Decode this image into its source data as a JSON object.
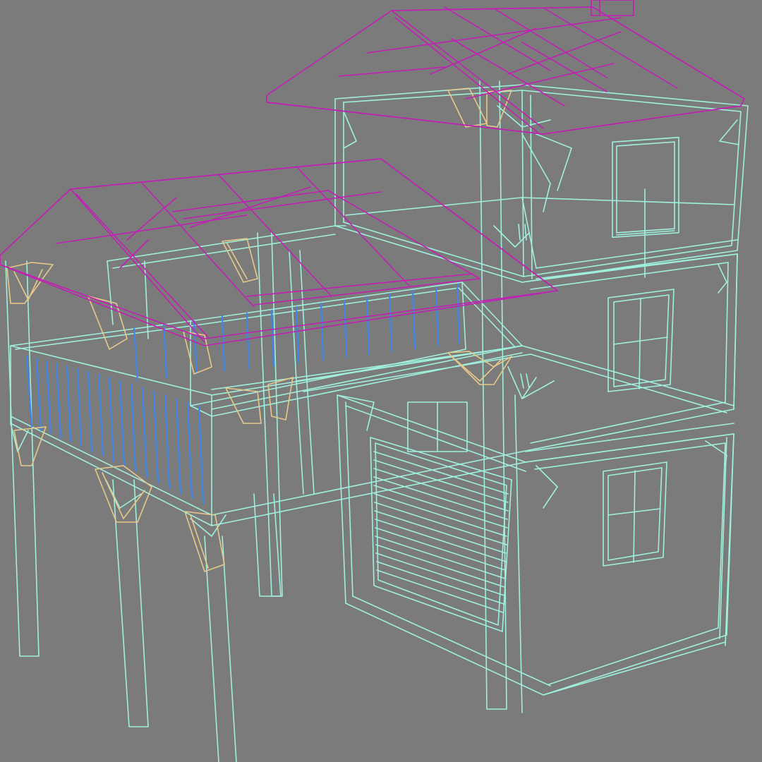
{
  "viewport": {
    "background": "#7b7b7b"
  },
  "wireframe_colors": {
    "structure": "#9ff0dd",
    "roof": "#c21fb5",
    "brackets": "#e8c98a",
    "balusters": "#3f86e6"
  }
}
